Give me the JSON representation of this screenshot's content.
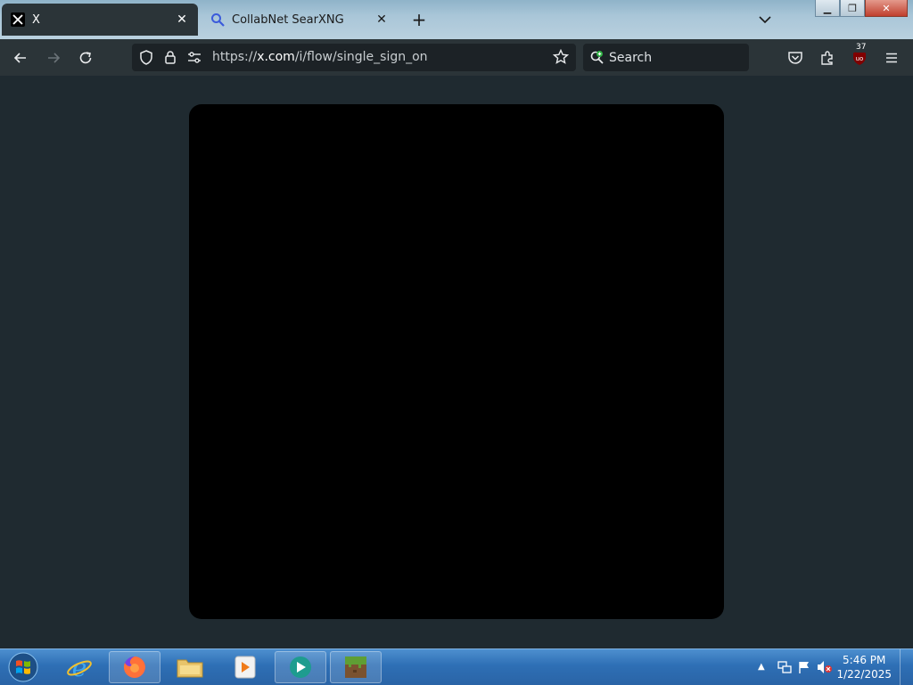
{
  "browser": {
    "tabs": [
      {
        "title": "X",
        "active": true
      },
      {
        "title": "CollabNet SearXNG",
        "active": false
      }
    ],
    "url_prefix": "https://",
    "url_host": "x.com",
    "url_path": "/i/flow/single_sign_on",
    "search_placeholder": "Search",
    "extension_badge": "37"
  },
  "taskbar": {
    "time": "5:46 PM",
    "date": "1/22/2025"
  },
  "colors": {
    "page_background": "#1f2a30",
    "modal_background": "#000000",
    "toolbar": "#2b3438"
  }
}
